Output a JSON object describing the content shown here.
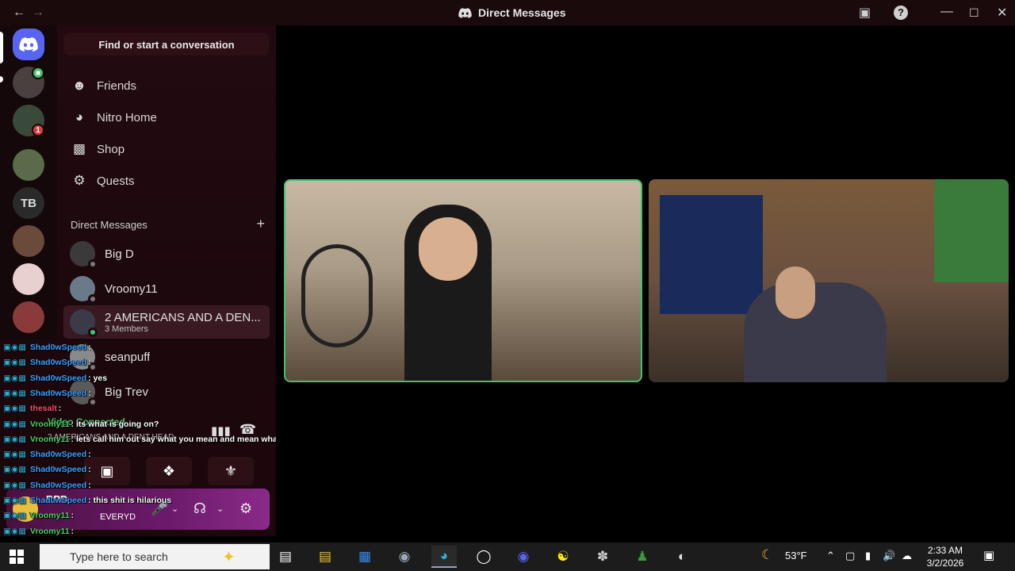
{
  "window": {
    "title": "Direct Messages",
    "back_icon": "←",
    "forward_icon": "→"
  },
  "rail": {
    "servers": [
      {
        "name": "home",
        "label": ""
      },
      {
        "name": "server-1",
        "label": ""
      },
      {
        "name": "server-2",
        "label": "",
        "badge": "1"
      },
      {
        "name": "server-3",
        "label": ""
      },
      {
        "name": "server-4",
        "label": "TB"
      },
      {
        "name": "server-5",
        "label": ""
      },
      {
        "name": "server-6",
        "label": ""
      },
      {
        "name": "server-7",
        "label": ""
      }
    ]
  },
  "sidebar": {
    "search_placeholder": "Find or start a conversation",
    "nav": [
      {
        "label": "Friends",
        "icon": "friends-icon"
      },
      {
        "label": "Nitro Home",
        "icon": "nitro-icon"
      },
      {
        "label": "Shop",
        "icon": "shop-icon"
      },
      {
        "label": "Quests",
        "icon": "quests-icon"
      }
    ],
    "dm_header": "Direct Messages",
    "dm_add": "+",
    "dms": [
      {
        "name": "Big D",
        "sub": ""
      },
      {
        "name": "Vroomy11",
        "sub": ""
      },
      {
        "name": "2 AMERICANS AND A DEN...",
        "sub": "3 Members"
      },
      {
        "name": "seanpuff",
        "sub": ""
      },
      {
        "name": "Big Trev",
        "sub": ""
      }
    ]
  },
  "voice": {
    "status": "Video Connected",
    "channel": "2 AMERICANS AND A DENT HEAD",
    "user_name": "BPD",
    "user_status": "EVERYD"
  },
  "chat": [
    {
      "user": "Shad0wSpeed",
      "msg": ":",
      "color": "#3da0ff"
    },
    {
      "user": "Shad0wSpeed",
      "msg": ":",
      "color": "#3da0ff"
    },
    {
      "user": "Shad0wSpeed",
      "msg": ": yes",
      "color": "#3da0ff"
    },
    {
      "user": "Shad0wSpeed",
      "msg": ":",
      "color": "#3da0ff"
    },
    {
      "user": "thesalt",
      "msg": ":",
      "color": "#ff4a6a"
    },
    {
      "user": "Vroomy11",
      "msg": ": its what is going on?",
      "color": "#4ad66a"
    },
    {
      "user": "Vroomy11",
      "msg": ": lets call him out say what you mean and mean what you say",
      "color": "#4ad66a"
    },
    {
      "user": "Shad0wSpeed",
      "msg": ":",
      "color": "#3da0ff"
    },
    {
      "user": "Shad0wSpeed",
      "msg": ":",
      "color": "#3da0ff"
    },
    {
      "user": "Shad0wSpeed",
      "msg": ":",
      "color": "#3da0ff"
    },
    {
      "user": "Shad0wSpeed",
      "msg": ": this shit is hilarious",
      "color": "#3da0ff"
    },
    {
      "user": "Vroomy11",
      "msg": ":",
      "color": "#4ad66a"
    },
    {
      "user": "Vroomy11",
      "msg": ":",
      "color": "#4ad66a"
    },
    {
      "user": "Shad0wSpeed",
      "msg": ":",
      "color": "#3da0ff"
    },
    {
      "user": "Shad0wSpeed",
      "msg": ":",
      "color": "#3da0ff"
    }
  ],
  "taskbar": {
    "search_placeholder": "Type here to search",
    "weather": "53°F",
    "time": "2:33 AM",
    "date": "3/2/2026"
  },
  "colors": {
    "accent_green": "#3ec46d",
    "badge_red": "#e03a3e"
  }
}
